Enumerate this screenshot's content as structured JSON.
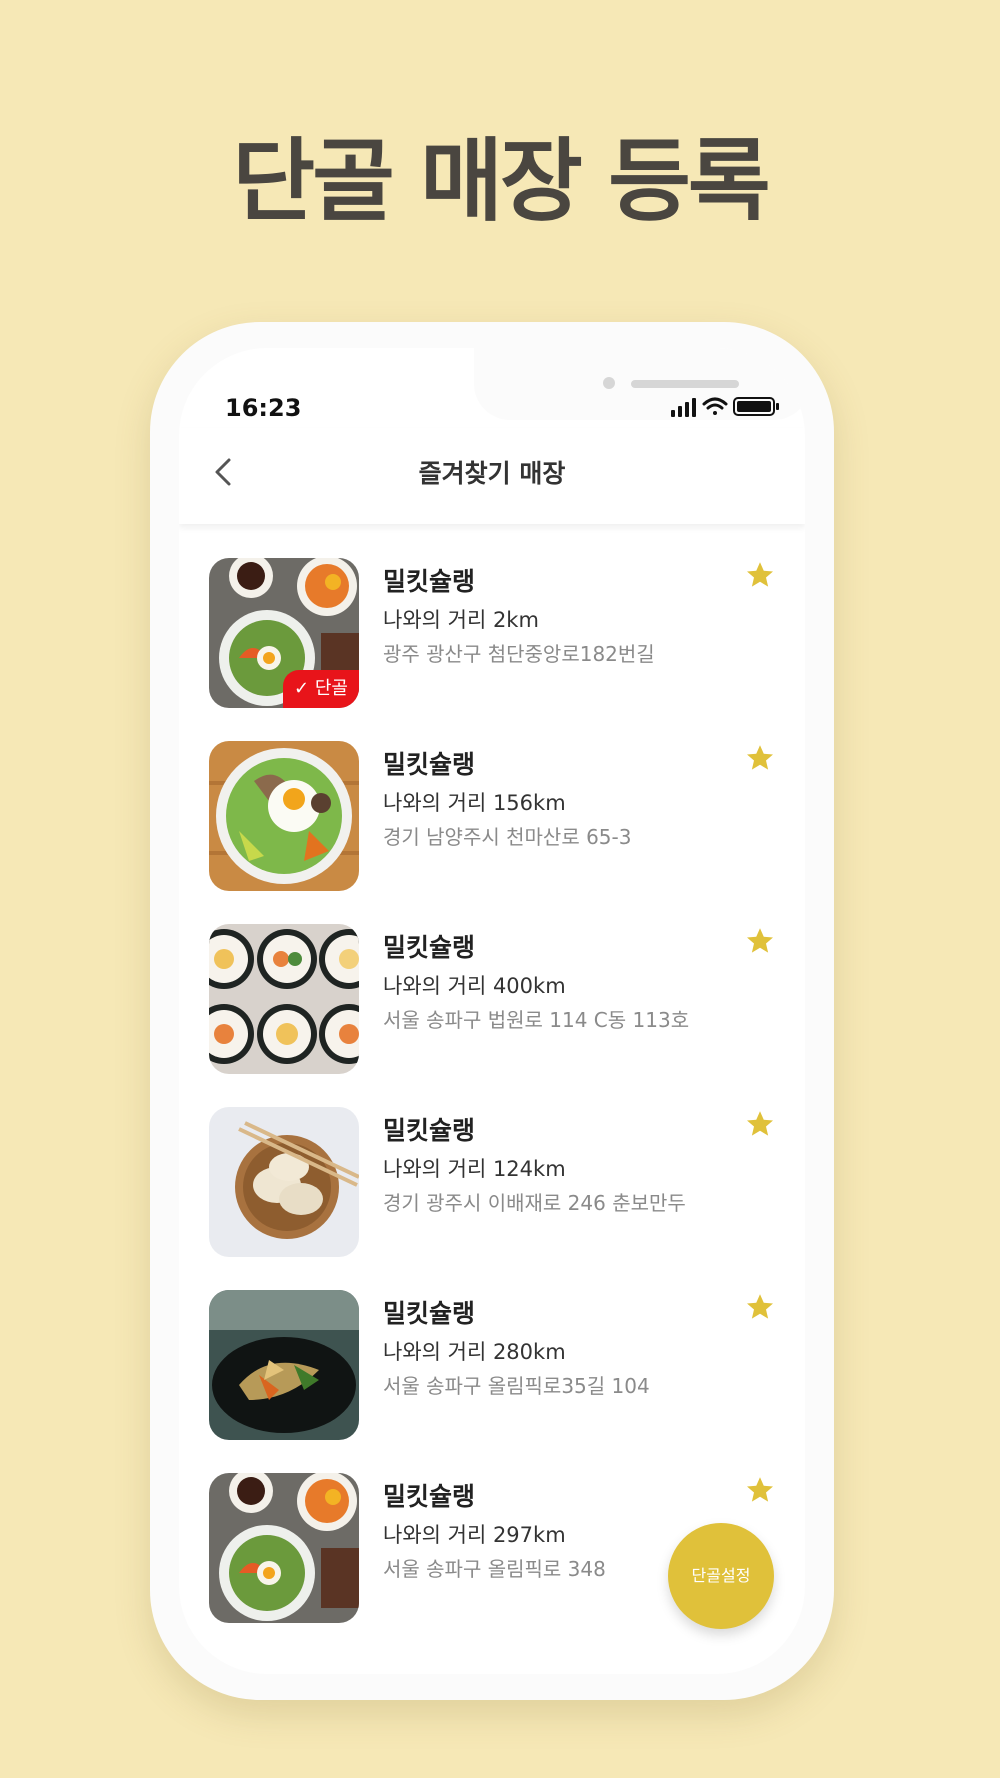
{
  "headline": "단골 매장 등록",
  "status_bar": {
    "time": "16:23"
  },
  "navbar": {
    "title": "즐겨찾기 매장"
  },
  "accent_color": "#e0c13a",
  "badge_color": "#e8141a",
  "stores": [
    {
      "name": "밀킷슐랭",
      "distance": "나와의 거리 2km",
      "address": "광주 광산구 첨단중앙로182번길",
      "badge": "✓ 단골",
      "image": "bibimbap"
    },
    {
      "name": "밀킷슐랭",
      "distance": "나와의 거리 156km",
      "address": "경기 남양주시 천마산로 65-3",
      "image": "bibimbap-egg"
    },
    {
      "name": "밀킷슐랭",
      "distance": "나와의 거리 400km",
      "address": "서울 송파구 법원로 114 C동 113호",
      "image": "gimbap"
    },
    {
      "name": "밀킷슐랭",
      "distance": "나와의 거리 124km",
      "address": "경기 광주시 이배재로 246 춘보만두",
      "image": "dumplings"
    },
    {
      "name": "밀킷슐랭",
      "distance": "나와의 거리 280km",
      "address": "서울 송파구 올림픽로35길 104",
      "image": "japchae"
    },
    {
      "name": "밀킷슐랭",
      "distance": "나와의 거리 297km",
      "address": "서울 송파구 올림픽로 348",
      "image": "bibimbap"
    }
  ],
  "fab": {
    "label": "단골설정"
  }
}
